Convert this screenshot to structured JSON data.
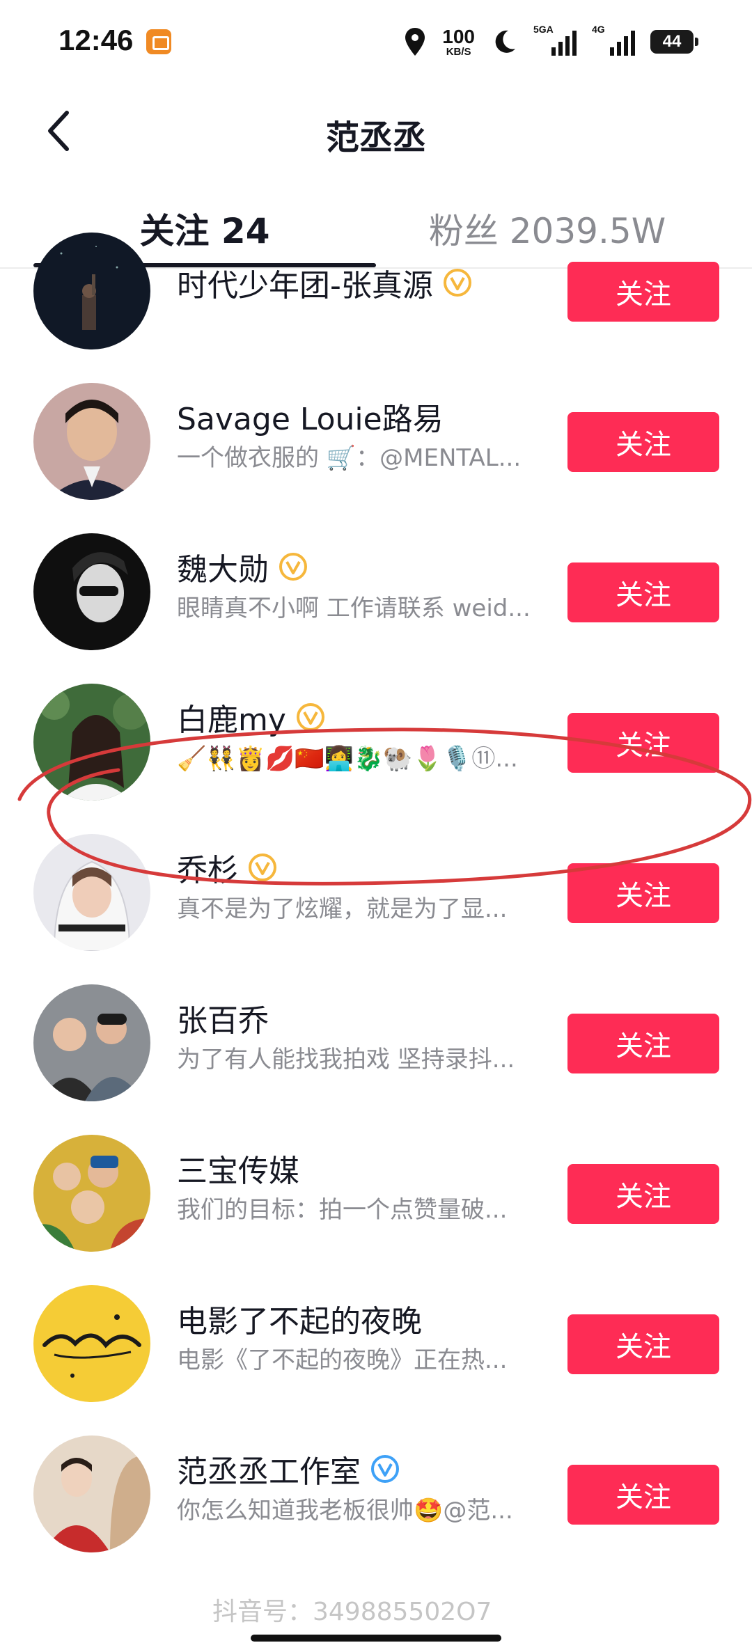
{
  "status_bar": {
    "time": "12:46",
    "net_speed": "100",
    "net_unit": "KB/S",
    "sim1_label": "5GA",
    "sim2_label": "4G",
    "battery": "44"
  },
  "header": {
    "title": "范丞丞",
    "back_icon": "chevron-left-icon"
  },
  "tabs": [
    {
      "label": "关注 24",
      "active": true
    },
    {
      "label": "粉丝 2039.5W",
      "active": false
    }
  ],
  "follow_label": "关注",
  "users": [
    {
      "name": "时代少年团-张真源",
      "subtitle": "",
      "verified": "gold"
    },
    {
      "name": "Savage Louie路易",
      "subtitle": "一个做衣服的 🛒：@MENTAL...",
      "verified": ""
    },
    {
      "name": "魏大勋",
      "subtitle": "眼睛真不小啊 工作请联系 weid...",
      "verified": "gold"
    },
    {
      "name": "白鹿my",
      "subtitle": "🧹👯👸💋🇨🇳👩‍💻🐉🐏🌷🎙️⑪...",
      "verified": "gold"
    },
    {
      "name": "乔杉",
      "subtitle": "真不是为了炫耀，就是为了显...",
      "verified": "gold"
    },
    {
      "name": "张百乔",
      "subtitle": "为了有人能找我拍戏 坚持录抖...",
      "verified": ""
    },
    {
      "name": "三宝传媒",
      "subtitle": "我们的目标：拍一个点赞量破...",
      "verified": ""
    },
    {
      "name": "电影了不起的夜晚",
      "subtitle": "电影《了不起的夜晚》正在热...",
      "verified": ""
    },
    {
      "name": "范丞丞工作室",
      "subtitle": "你怎么知道我老板很帅🤩@范...",
      "verified": "blue"
    }
  ],
  "watermark": "抖音号：349885502O7",
  "colors": {
    "accent": "#fe2c55",
    "text_primary": "#161823",
    "text_secondary": "#8a8b91",
    "verified_gold": "#f6b73c",
    "verified_blue": "#3ea1f7",
    "annotation_red": "#d63a3a"
  }
}
